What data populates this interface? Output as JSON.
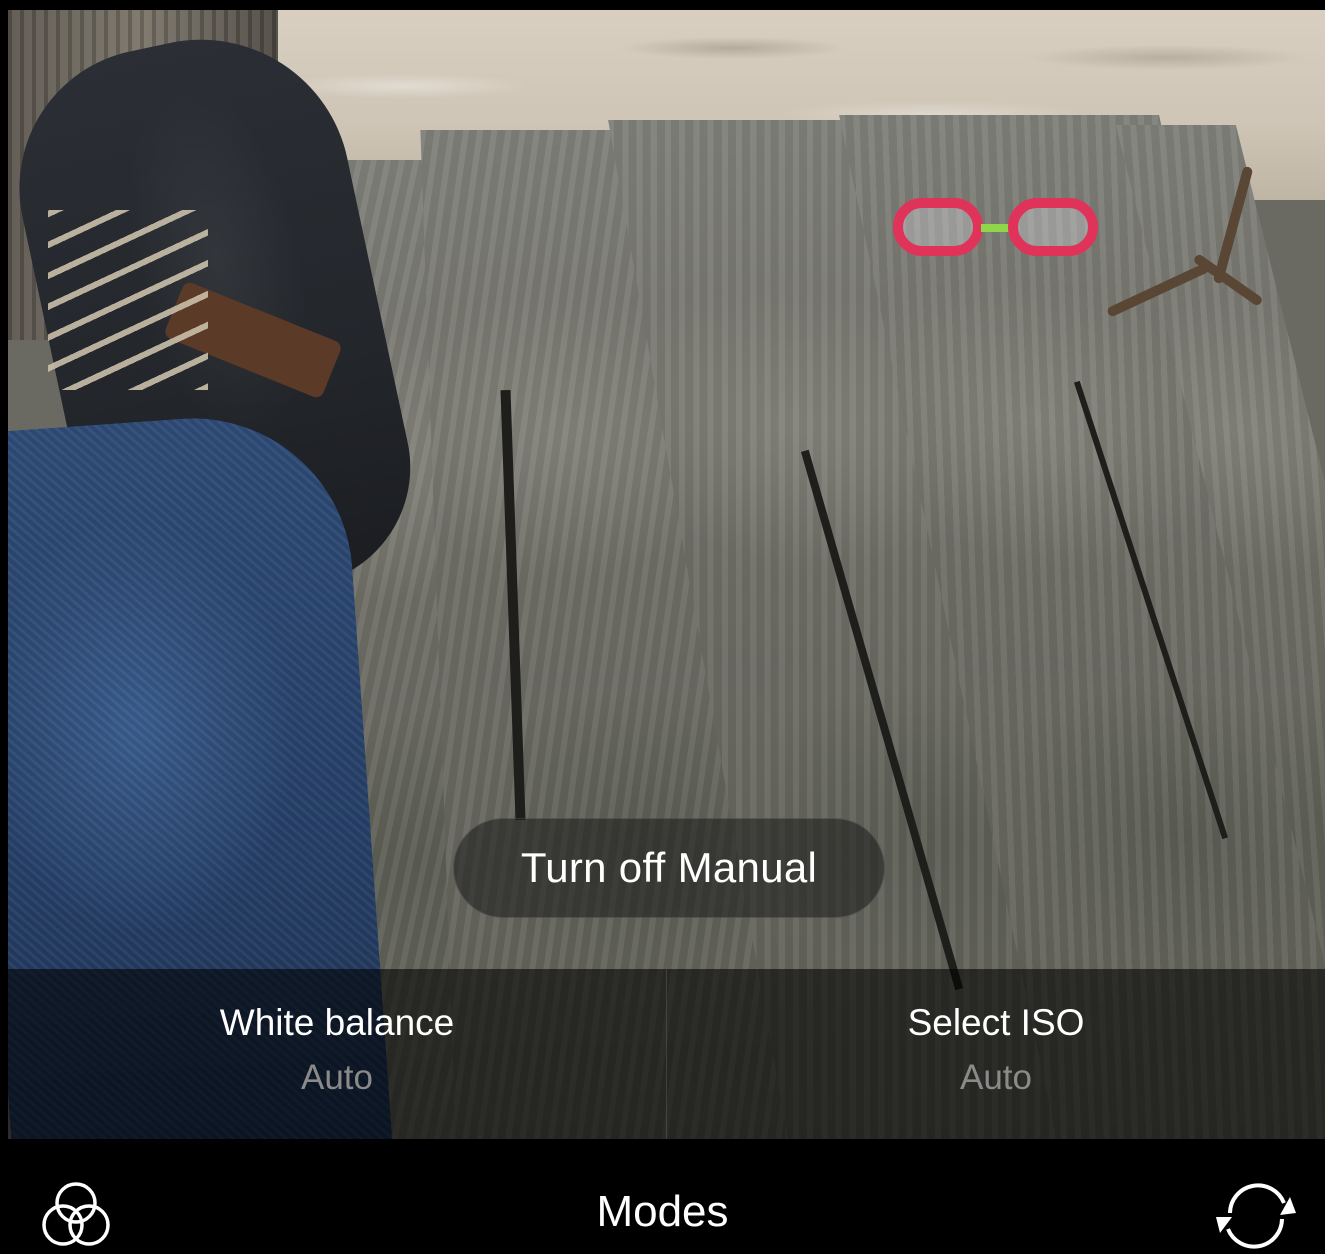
{
  "viewfinder": {
    "description_icon": "camera-preview"
  },
  "manual_toggle": {
    "label": "Turn off Manual"
  },
  "settings": [
    {
      "label": "White balance",
      "value": "Auto"
    },
    {
      "label": "Select ISO",
      "value": "Auto"
    }
  ],
  "bottom_bar": {
    "left_icon": "filters-icon",
    "modes_label": "Modes",
    "right_icon": "switch-camera-icon"
  },
  "colors": {
    "pill_bg": "#191919",
    "strip_bg": "#000000",
    "label_text": "#ffffff",
    "value_text": "#8a8a8a"
  }
}
